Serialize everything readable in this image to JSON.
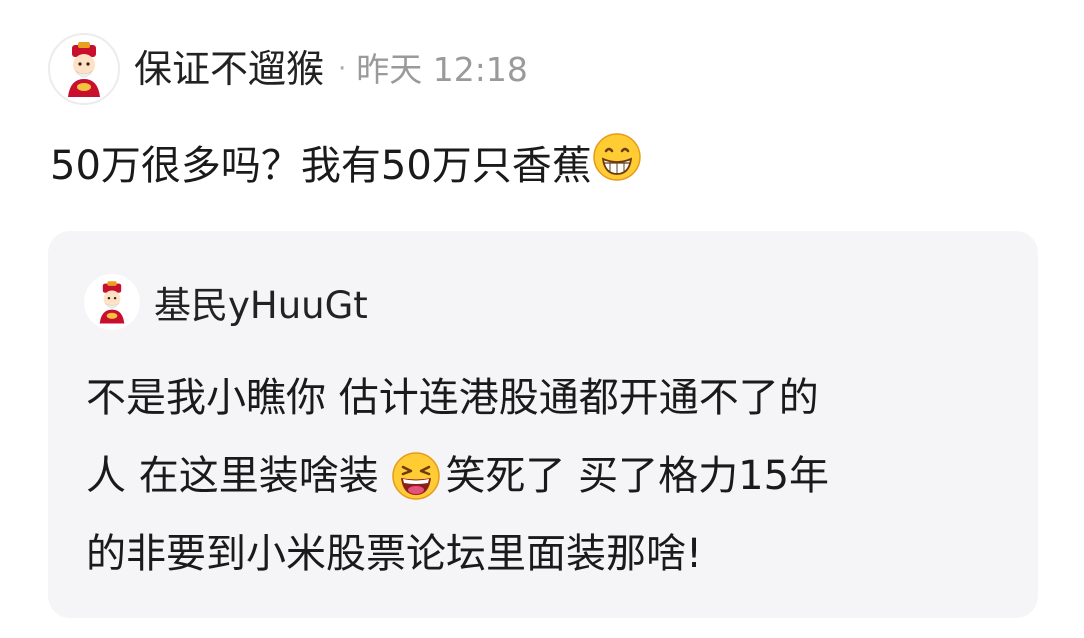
{
  "post": {
    "author": "保证不遛猴",
    "separator": "·",
    "time": "昨天 12:18",
    "text": "50万很多吗？我有50万只香蕉",
    "emoji": "grinning-face-icon"
  },
  "quote": {
    "author": "基民yHuuGt",
    "line1": "不是我小瞧你 估计连港股通都开通不了的",
    "line2_before_emoji": "人 在这里装啥装 ",
    "line2_after_emoji": "笑死了 买了格力15年",
    "line3": "的非要到小米股票论坛里面装那啥!",
    "emoji": "laughing-face-icon"
  },
  "colors": {
    "quote_background": "#f5f5f7",
    "meta_text": "#9a9a9a",
    "emoji_yellow": "#ffcc33"
  }
}
